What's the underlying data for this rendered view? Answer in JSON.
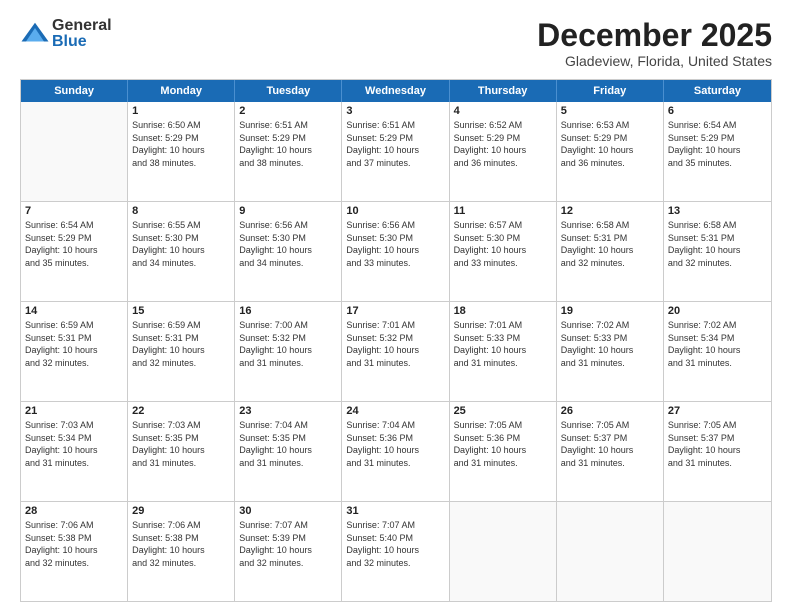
{
  "logo": {
    "general": "General",
    "blue": "Blue"
  },
  "header": {
    "month": "December 2025",
    "location": "Gladeview, Florida, United States"
  },
  "weekdays": [
    "Sunday",
    "Monday",
    "Tuesday",
    "Wednesday",
    "Thursday",
    "Friday",
    "Saturday"
  ],
  "rows": [
    [
      {
        "day": "",
        "info": ""
      },
      {
        "day": "1",
        "info": "Sunrise: 6:50 AM\nSunset: 5:29 PM\nDaylight: 10 hours\nand 38 minutes."
      },
      {
        "day": "2",
        "info": "Sunrise: 6:51 AM\nSunset: 5:29 PM\nDaylight: 10 hours\nand 38 minutes."
      },
      {
        "day": "3",
        "info": "Sunrise: 6:51 AM\nSunset: 5:29 PM\nDaylight: 10 hours\nand 37 minutes."
      },
      {
        "day": "4",
        "info": "Sunrise: 6:52 AM\nSunset: 5:29 PM\nDaylight: 10 hours\nand 36 minutes."
      },
      {
        "day": "5",
        "info": "Sunrise: 6:53 AM\nSunset: 5:29 PM\nDaylight: 10 hours\nand 36 minutes."
      },
      {
        "day": "6",
        "info": "Sunrise: 6:54 AM\nSunset: 5:29 PM\nDaylight: 10 hours\nand 35 minutes."
      }
    ],
    [
      {
        "day": "7",
        "info": "Sunrise: 6:54 AM\nSunset: 5:29 PM\nDaylight: 10 hours\nand 35 minutes."
      },
      {
        "day": "8",
        "info": "Sunrise: 6:55 AM\nSunset: 5:30 PM\nDaylight: 10 hours\nand 34 minutes."
      },
      {
        "day": "9",
        "info": "Sunrise: 6:56 AM\nSunset: 5:30 PM\nDaylight: 10 hours\nand 34 minutes."
      },
      {
        "day": "10",
        "info": "Sunrise: 6:56 AM\nSunset: 5:30 PM\nDaylight: 10 hours\nand 33 minutes."
      },
      {
        "day": "11",
        "info": "Sunrise: 6:57 AM\nSunset: 5:30 PM\nDaylight: 10 hours\nand 33 minutes."
      },
      {
        "day": "12",
        "info": "Sunrise: 6:58 AM\nSunset: 5:31 PM\nDaylight: 10 hours\nand 32 minutes."
      },
      {
        "day": "13",
        "info": "Sunrise: 6:58 AM\nSunset: 5:31 PM\nDaylight: 10 hours\nand 32 minutes."
      }
    ],
    [
      {
        "day": "14",
        "info": "Sunrise: 6:59 AM\nSunset: 5:31 PM\nDaylight: 10 hours\nand 32 minutes."
      },
      {
        "day": "15",
        "info": "Sunrise: 6:59 AM\nSunset: 5:31 PM\nDaylight: 10 hours\nand 32 minutes."
      },
      {
        "day": "16",
        "info": "Sunrise: 7:00 AM\nSunset: 5:32 PM\nDaylight: 10 hours\nand 31 minutes."
      },
      {
        "day": "17",
        "info": "Sunrise: 7:01 AM\nSunset: 5:32 PM\nDaylight: 10 hours\nand 31 minutes."
      },
      {
        "day": "18",
        "info": "Sunrise: 7:01 AM\nSunset: 5:33 PM\nDaylight: 10 hours\nand 31 minutes."
      },
      {
        "day": "19",
        "info": "Sunrise: 7:02 AM\nSunset: 5:33 PM\nDaylight: 10 hours\nand 31 minutes."
      },
      {
        "day": "20",
        "info": "Sunrise: 7:02 AM\nSunset: 5:34 PM\nDaylight: 10 hours\nand 31 minutes."
      }
    ],
    [
      {
        "day": "21",
        "info": "Sunrise: 7:03 AM\nSunset: 5:34 PM\nDaylight: 10 hours\nand 31 minutes."
      },
      {
        "day": "22",
        "info": "Sunrise: 7:03 AM\nSunset: 5:35 PM\nDaylight: 10 hours\nand 31 minutes."
      },
      {
        "day": "23",
        "info": "Sunrise: 7:04 AM\nSunset: 5:35 PM\nDaylight: 10 hours\nand 31 minutes."
      },
      {
        "day": "24",
        "info": "Sunrise: 7:04 AM\nSunset: 5:36 PM\nDaylight: 10 hours\nand 31 minutes."
      },
      {
        "day": "25",
        "info": "Sunrise: 7:05 AM\nSunset: 5:36 PM\nDaylight: 10 hours\nand 31 minutes."
      },
      {
        "day": "26",
        "info": "Sunrise: 7:05 AM\nSunset: 5:37 PM\nDaylight: 10 hours\nand 31 minutes."
      },
      {
        "day": "27",
        "info": "Sunrise: 7:05 AM\nSunset: 5:37 PM\nDaylight: 10 hours\nand 31 minutes."
      }
    ],
    [
      {
        "day": "28",
        "info": "Sunrise: 7:06 AM\nSunset: 5:38 PM\nDaylight: 10 hours\nand 32 minutes."
      },
      {
        "day": "29",
        "info": "Sunrise: 7:06 AM\nSunset: 5:38 PM\nDaylight: 10 hours\nand 32 minutes."
      },
      {
        "day": "30",
        "info": "Sunrise: 7:07 AM\nSunset: 5:39 PM\nDaylight: 10 hours\nand 32 minutes."
      },
      {
        "day": "31",
        "info": "Sunrise: 7:07 AM\nSunset: 5:40 PM\nDaylight: 10 hours\nand 32 minutes."
      },
      {
        "day": "",
        "info": ""
      },
      {
        "day": "",
        "info": ""
      },
      {
        "day": "",
        "info": ""
      }
    ]
  ]
}
